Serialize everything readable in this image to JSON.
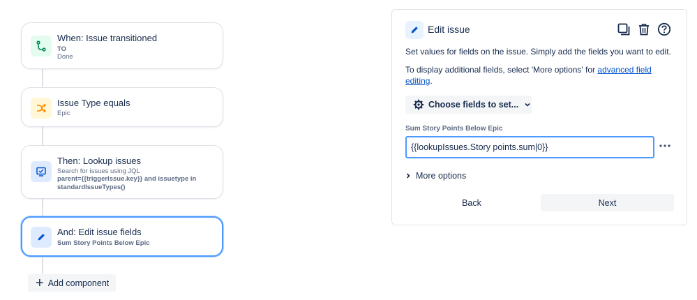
{
  "flow": {
    "cards": [
      {
        "title": "When: Issue transitioned",
        "sub_bold": "TO",
        "sub": "Done",
        "icon": "branch-icon",
        "icon_bg": "#e3fcef",
        "icon_color": "#00875a"
      },
      {
        "title": "Issue Type equals",
        "sub": "Epic",
        "icon": "shuffle-icon",
        "icon_bg": "#fff7d6",
        "icon_color": "#ff8b00"
      },
      {
        "title": "Then: Lookup issues",
        "sub": "Search for issues using JQL",
        "sub_bold": "parent={{triggerIssue.key}} and issuetype in standardIssueTypes()",
        "icon": "monitor-icon",
        "icon_bg": "#deebff",
        "icon_color": "#0052cc"
      },
      {
        "title": "And: Edit issue fields",
        "sub_bold": "Sum Story Points Below Epic",
        "icon": "pencil-icon",
        "icon_bg": "#deebff",
        "icon_color": "#0052cc"
      }
    ],
    "add_component_label": "Add component"
  },
  "panel": {
    "title": "Edit issue",
    "description": "Set values for fields on the issue. Simply add the fields you want to edit.",
    "additional_prefix": "To display additional fields, select 'More options' for ",
    "additional_link": "advanced field editing",
    "additional_suffix": ".",
    "choose_fields_label": "Choose fields to set...",
    "field_label": "Sum Story Points Below Epic",
    "field_value": "{{lookupIssues.Story points.sum|0}}",
    "more_options_label": "More options",
    "back_label": "Back",
    "next_label": "Next"
  },
  "colors": {
    "accent": "#4c9aff",
    "link": "#0052cc",
    "text": "#172b4d",
    "subtle": "#5e6c84"
  }
}
